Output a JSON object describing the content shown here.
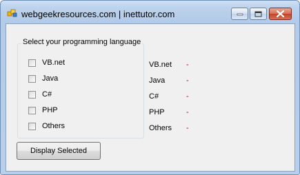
{
  "window": {
    "title": "webgeekresources.com | inettutor.com"
  },
  "group": {
    "title": "Select your programming language",
    "options": [
      "VB.net",
      "Java",
      "C#",
      "PHP",
      "Others"
    ]
  },
  "results": [
    {
      "label": "VB.net",
      "value": "-"
    },
    {
      "label": "Java",
      "value": "-"
    },
    {
      "label": "C#",
      "value": "-"
    },
    {
      "label": "PHP",
      "value": "-"
    },
    {
      "label": "Others",
      "value": "-"
    }
  ],
  "button": {
    "label": "Display Selected"
  },
  "colors": {
    "result_value": "#c00000"
  }
}
